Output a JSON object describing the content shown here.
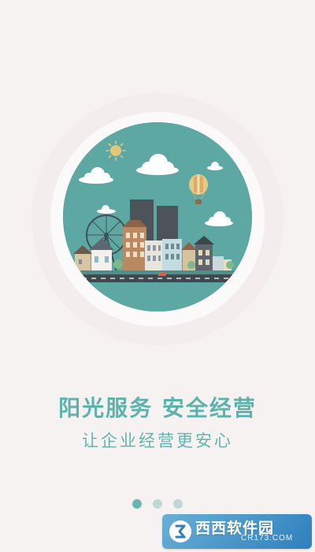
{
  "onboarding": {
    "headline": "阳光服务 安全经营",
    "subheadline": "让企业经营更安心",
    "illustration": "city-skyline-illustration",
    "pager": {
      "total": 3,
      "current": 1
    }
  },
  "watermark": {
    "brand": "西西软件园",
    "url": "CR173.COM"
  },
  "colors": {
    "background": "#f7f2f2",
    "accent": "#5cb3ab",
    "circle": "#5ea8a3",
    "dot_inactive": "#bfd8d5"
  }
}
